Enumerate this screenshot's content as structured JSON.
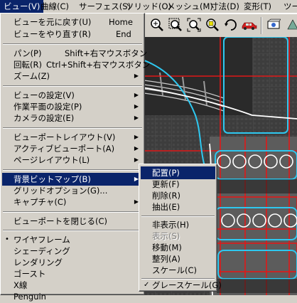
{
  "menubar": {
    "items": [
      {
        "label": "ビュー(V)"
      },
      {
        "label": "曲線(C)"
      },
      {
        "label": "サーフェス(S)"
      },
      {
        "label": "ソリッド(O)"
      },
      {
        "label": "メッシュ(M)"
      },
      {
        "label": "寸法(D)"
      },
      {
        "label": "変形(T)"
      },
      {
        "label": "ツー"
      }
    ]
  },
  "toolbar": {
    "icons": [
      "zoom-in-icon",
      "zoom-window-icon",
      "zoom-extents-icon",
      "zoom-selected-icon",
      "rotate-view-icon",
      "car-icon",
      "render-icon",
      "shade-icon"
    ]
  },
  "view_menu": {
    "items": [
      {
        "label": "ビューを元に戻す(U)",
        "shortcut": "Home"
      },
      {
        "label": "ビューをやり直す(R)",
        "shortcut": "End"
      },
      {
        "label": "パン(P)",
        "shortcut": "Shift+右マウスボタン"
      },
      {
        "label": "回転(R)",
        "shortcut": "Ctrl+Shift+右マウスボタン"
      },
      {
        "label": "ズーム(Z)"
      },
      {
        "label": "ビューの設定(V)"
      },
      {
        "label": "作業平面の設定(P)"
      },
      {
        "label": "カメラの設定(E)"
      },
      {
        "label": "ビューポートレイアウト(V)"
      },
      {
        "label": "アクティブビューポート(A)"
      },
      {
        "label": "ページレイアウト(L)"
      },
      {
        "label": "背景ビットマップ(B)"
      },
      {
        "label": "グリッドオプション(G)..."
      },
      {
        "label": "キャプチャ(C)"
      },
      {
        "label": "ビューポートを閉じる(C)"
      },
      {
        "label": "ワイヤフレーム",
        "bullet": "•"
      },
      {
        "label": "シェーディング"
      },
      {
        "label": "レンダリング"
      },
      {
        "label": "ゴースト"
      },
      {
        "label": "X線"
      },
      {
        "label": "Penguin"
      }
    ]
  },
  "bg_submenu": {
    "items": [
      {
        "label": "配置(P)"
      },
      {
        "label": "更新(F)"
      },
      {
        "label": "削除(R)"
      },
      {
        "label": "抽出(E)"
      },
      {
        "label": "非表示(H)"
      },
      {
        "label": "表示(S)"
      },
      {
        "label": "移動(M)"
      },
      {
        "label": "整列(A)"
      },
      {
        "label": "スケール(C)"
      },
      {
        "label": "グレースケール(G)",
        "check": "✓"
      }
    ]
  },
  "colors": {
    "highlight": "#0a246a",
    "menu_bg": "#d4d0c8",
    "curve_cyan": "#2ec8f0",
    "curve_red": "#e01818"
  }
}
